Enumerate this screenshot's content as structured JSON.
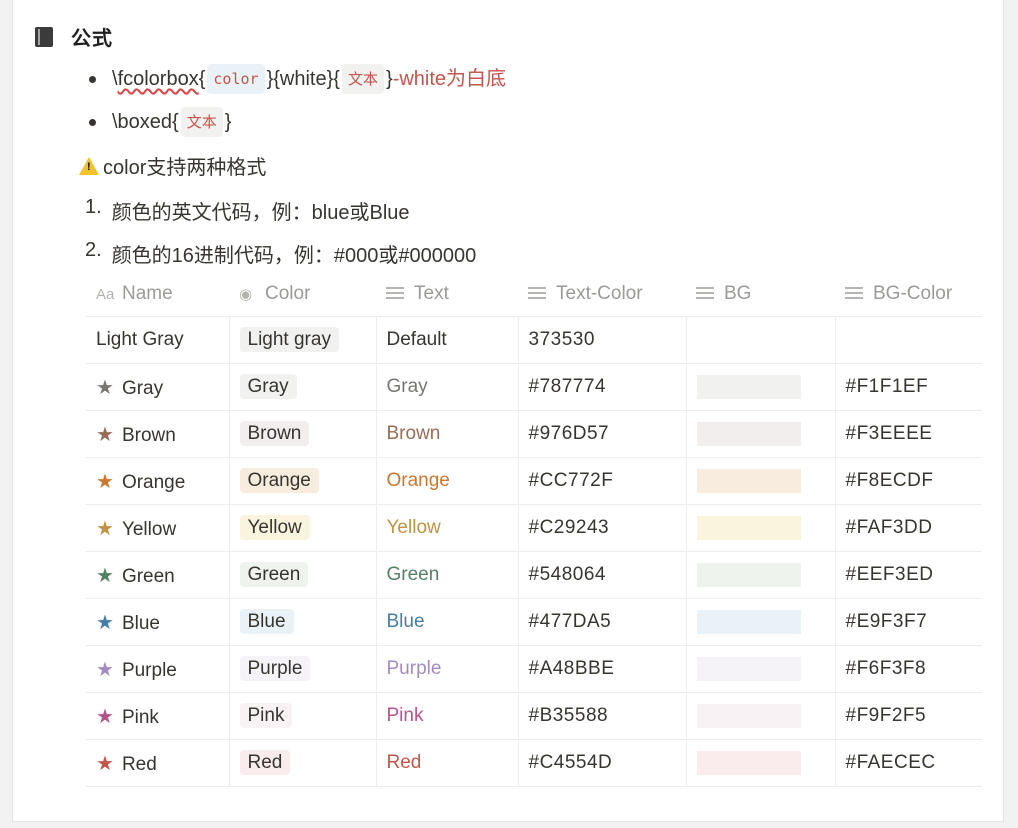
{
  "header": {
    "title": "公式"
  },
  "bullets": {
    "b1": {
      "a": "\\",
      "b": "fcolorbox",
      "c": "{",
      "code1": "color",
      "d": "}{white}{",
      "code2": "文本",
      "e": "}",
      "f": "-white为白底"
    },
    "b2": {
      "a": "\\boxed{",
      "code": "文本",
      "b": "}"
    }
  },
  "note": {
    "text": "color支持两种格式",
    "icon": "warning-icon"
  },
  "ordered": [
    {
      "num": "1.",
      "text": "颜色的英文代码，例：blue或Blue"
    },
    {
      "num": "2.",
      "text": "颜色的16进制代码，例：#000或#000000"
    }
  ],
  "table": {
    "headers": [
      "Name",
      "Color",
      "Text",
      "Text-Color",
      "BG",
      "BG-Color"
    ],
    "header_icons": [
      "Aa",
      "tag-icon",
      "text-lines-icon",
      "text-lines-icon",
      "text-lines-icon",
      "text-lines-icon"
    ],
    "rows": [
      {
        "name": "Light Gray",
        "color": "Light gray",
        "text": "Default",
        "text_color": "373530",
        "bg_color": "",
        "fg": "#37352f",
        "bg": "#f1f1ef",
        "star": false
      },
      {
        "name": "Gray",
        "color": "Gray",
        "text": "Gray",
        "text_color": "#787774",
        "bg_color": "#F1F1EF",
        "fg": "#787774",
        "bg": "#f1f1ef",
        "star": true
      },
      {
        "name": "Brown",
        "color": "Brown",
        "text": "Brown",
        "text_color": "#976D57",
        "bg_color": "#F3EEEE",
        "fg": "#976d57",
        "bg": "#f3eeee",
        "star": true
      },
      {
        "name": "Orange",
        "color": "Orange",
        "text": "Orange",
        "text_color": "#CC772F",
        "bg_color": "#F8ECDF",
        "fg": "#cc772f",
        "bg": "#f8ecdf",
        "star": true
      },
      {
        "name": "Yellow",
        "color": "Yellow",
        "text": "Yellow",
        "text_color": "#C29243",
        "bg_color": "#FAF3DD",
        "fg": "#c29243",
        "bg": "#faf3dd",
        "star": true
      },
      {
        "name": "Green",
        "color": "Green",
        "text": "Green",
        "text_color": "#548064",
        "bg_color": "#EEF3ED",
        "fg": "#548064",
        "bg": "#eef3ed",
        "star": true
      },
      {
        "name": "Blue",
        "color": "Blue",
        "text": "Blue",
        "text_color": "#477DA5",
        "bg_color": "#E9F3F7",
        "fg": "#477da5",
        "bg": "#e9f3f7",
        "star": true
      },
      {
        "name": "Purple",
        "color": "Purple",
        "text": "Purple",
        "text_color": "#A48BBE",
        "bg_color": "#F6F3F8",
        "fg": "#a48bbe",
        "bg": "#f6f3f8",
        "star": true
      },
      {
        "name": "Pink",
        "color": "Pink",
        "text": "Pink",
        "text_color": "#B35588",
        "bg_color": "#F9F2F5",
        "fg": "#b35588",
        "bg": "#f9f2f5",
        "star": true
      },
      {
        "name": "Red",
        "color": "Red",
        "text": "Red",
        "text_color": "#C4554D",
        "bg_color": "#FAECEC",
        "fg": "#c4554d",
        "bg": "#faecec",
        "star": true
      }
    ]
  }
}
